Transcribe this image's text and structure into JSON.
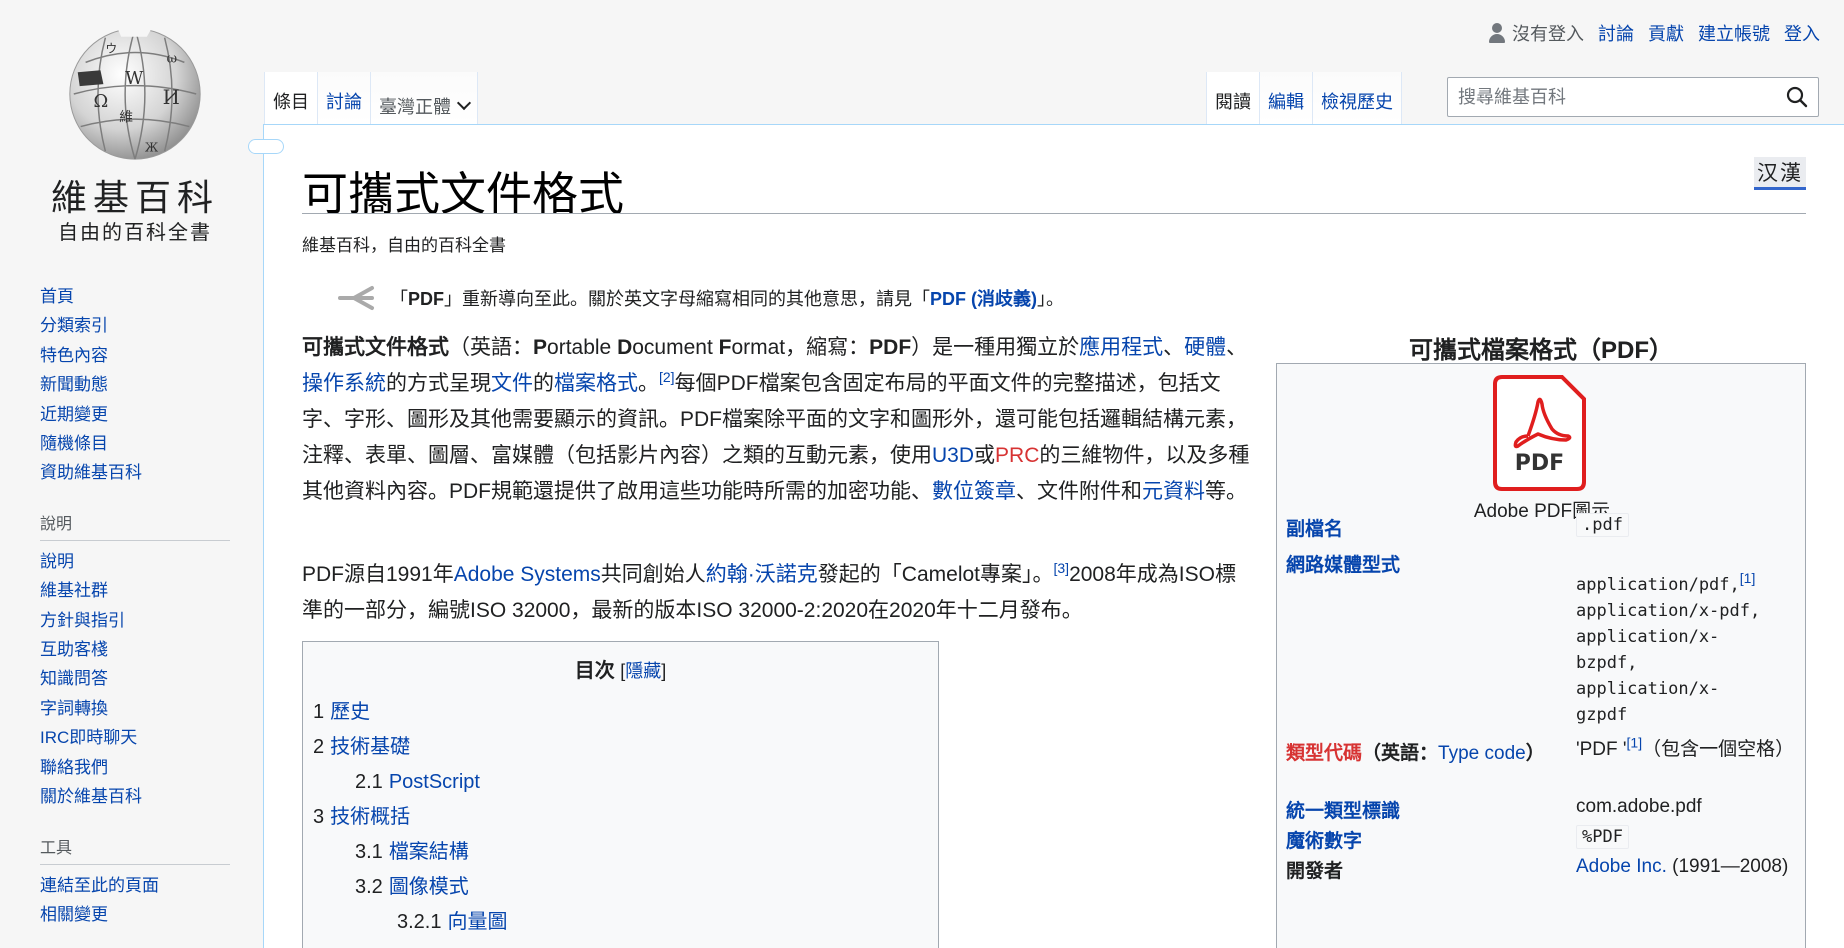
{
  "user_nav": {
    "not_logged_in": "沒有登入",
    "talk": "討論",
    "contributions": "貢獻",
    "create_account": "建立帳號",
    "login": "登入"
  },
  "logo": {
    "title": "維基百科",
    "tagline": "自由的百科全書"
  },
  "sidebar": {
    "navigation": [
      "首頁",
      "分類索引",
      "特色內容",
      "新聞動態",
      "近期變更",
      "隨機條目",
      "資助維基百科"
    ],
    "help_heading": "說明",
    "help": [
      "說明",
      "維基社群",
      "方針與指引",
      "互助客棧",
      "知識問答",
      "字詞轉換",
      "IRC即時聊天",
      "聯絡我們",
      "關於維基百科"
    ],
    "tools_heading": "工具",
    "tools": [
      "連結至此的頁面",
      "相關變更"
    ]
  },
  "tabs": {
    "article": "條目",
    "talk": "討論",
    "variant": "臺灣正體",
    "read": "閱讀",
    "edit": "編輯",
    "history": "檢視歷史"
  },
  "search": {
    "placeholder": "搜尋維基百科"
  },
  "page": {
    "title": "可攜式文件格式",
    "variant_badge": "汉漢",
    "site_sub": "維基百科，自由的百科全書",
    "hatnote": {
      "pre": "「",
      "bold": "PDF",
      "mid": "」重新導向至此。關於英文字母縮寫相同的其他意思，請見「",
      "link": "PDF (消歧義)",
      "post": "」。"
    },
    "para1": {
      "bold": "可攜式文件格式",
      "t1": "（英語：",
      "P": "P",
      "t2": "ortable ",
      "D": "D",
      "t3": "ocument ",
      "F": "F",
      "t4": "ormat，縮寫：",
      "pdf": "PDF",
      "t5": "）是一種用獨立於",
      "l1": "應用程式",
      "s1": "、",
      "l2": "硬體",
      "s2": "、",
      "l3": "操作系統",
      "t6": "的方式呈現",
      "l4": "文件",
      "t7": "的",
      "l5": "檔案格式",
      "t8": "。",
      "ref": "[2]",
      "t9": "每個PDF檔案包含固定布局的平面文件的完整描述，包括文字、字形、圖形及其他需要顯示的資訊。PDF檔案除平面的文字和圖形外，還可能包括邏輯結構元素，注釋、表單、圖層、富媒體（包括影片內容）之類的互動元素，使用",
      "l6": "U3D",
      "t10": "或",
      "l7": "PRC",
      "t11": "的三維物件，以及多種其他資料內容。PDF規範還提供了啟用這些功能時所需的加密功能、",
      "l8": "數位簽章",
      "t12": "、文件附件和",
      "l9": "元資料",
      "t13": "等。"
    },
    "para2": {
      "t1": "PDF源自1991年",
      "l1": "Adobe Systems",
      "t2": "共同創始人",
      "l2": "約翰·沃諾克",
      "t3": "發起的「Camelot專案」。",
      "ref": "[3]",
      "t4": "2008年成為ISO標準的一部分，編號ISO 32000，最新的版本ISO 32000-2:2020在2020年十二月發布。"
    }
  },
  "toc": {
    "title": "目次",
    "toggle_open": "[",
    "toggle": "隱藏",
    "toggle_close": "]",
    "items": [
      {
        "num": "1",
        "label": "歷史"
      },
      {
        "num": "2",
        "label": "技術基礎"
      },
      {
        "num": "2.1",
        "label": "PostScript"
      },
      {
        "num": "3",
        "label": "技術概括"
      },
      {
        "num": "3.1",
        "label": "檔案結構"
      },
      {
        "num": "3.2",
        "label": "圖像模式"
      },
      {
        "num": "3.2.1",
        "label": "向量圖"
      }
    ]
  },
  "infobox": {
    "caption": "可攜式檔案格式（PDF）",
    "icon_text": "PDF",
    "image_caption": "Adobe PDF圖示",
    "ext_label": "副檔名",
    "ext_value": ".pdf",
    "mime_label": "網路媒體型式",
    "mime_l1": "application/pdf,",
    "mime_ref": "[1]",
    "mime_l2": "application/x-pdf,",
    "mime_l3": "application/x-",
    "mime_l4": "bzpdf,",
    "mime_l5": "application/x-",
    "mime_l6": "gzpdf",
    "type_label": "類型代碼",
    "type_label_mid": "（英語：",
    "type_label_link": "Type code",
    "type_label_end": "）",
    "type_value": "'PDF '",
    "type_ref": "[1]",
    "type_note": "（包含一個空格）",
    "uti_label": "統一類型標識",
    "uti_value": "com.adobe.pdf",
    "magic_label": "魔術數字",
    "magic_value": "%PDF",
    "dev_label": "開發者",
    "dev_link": "Adobe Inc.",
    "dev_years": " (1991—2008)"
  }
}
